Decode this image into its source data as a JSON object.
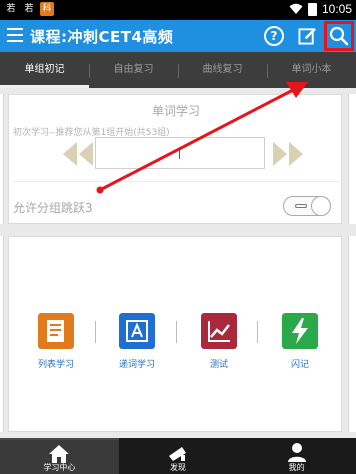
{
  "status_bar": {
    "icon_1": "若",
    "icon_2": "若",
    "icon_3": "科",
    "time": "10:05"
  },
  "app_bar": {
    "title": "课程:冲刺CET4高频",
    "help_glyph": "?"
  },
  "tabs": [
    {
      "label": "单组初记",
      "active": true
    },
    {
      "label": "自由复习",
      "active": false
    },
    {
      "label": "曲线复习",
      "active": false
    },
    {
      "label": "单词小本",
      "active": false
    }
  ],
  "word_card": {
    "title": "单词学习",
    "subtitle": "初次学习--推荐您从第1组开始(共53组)",
    "group_value": "",
    "toggle_label": "允许分组跳跃3",
    "toggle_on": false
  },
  "features": [
    {
      "label": "列表学习",
      "icon": "list-study-icon",
      "color": "#e07a1d"
    },
    {
      "label": "递词学习",
      "icon": "word-study-icon",
      "color": "#1f6fd0"
    },
    {
      "label": "测试",
      "icon": "test-chart-icon",
      "color": "#a8283c"
    },
    {
      "label": "闪记",
      "icon": "flash-icon",
      "color": "#2aa84a"
    }
  ],
  "bottom_nav": [
    {
      "label": "学习中心",
      "icon": "home-icon",
      "active": true
    },
    {
      "label": "发现",
      "icon": "discover-icon",
      "active": false
    },
    {
      "label": "我的",
      "icon": "profile-icon",
      "active": false
    }
  ],
  "colors": {
    "app_bar": "#1f8fe0",
    "highlight": "#e8141c",
    "tab_bar": "#3d3d3d",
    "nav_arrows": "#d9d1b4"
  }
}
